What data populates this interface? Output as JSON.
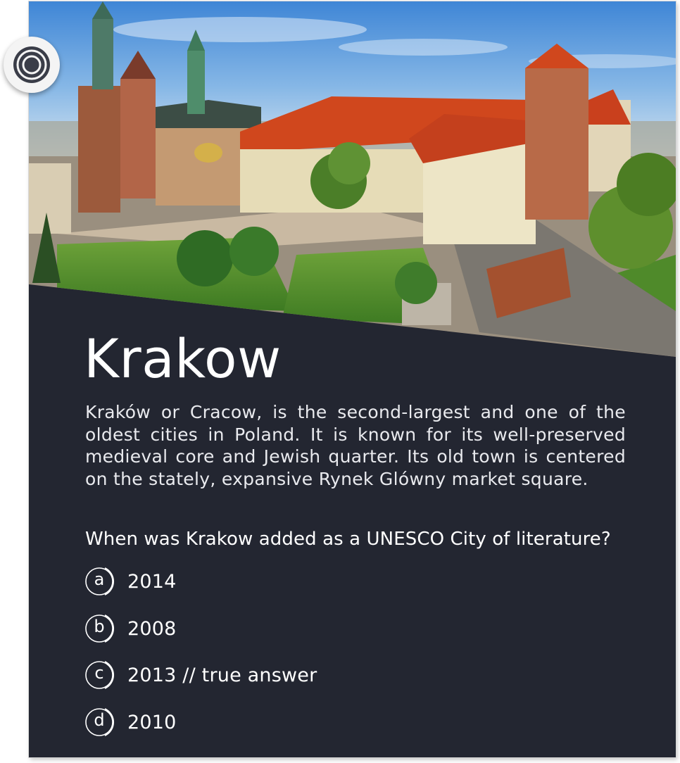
{
  "city": {
    "title": "Krakow",
    "description": "Kraków or Cracow, is the second-largest and one of the oldest cities in Poland. It is known for its well-preserved medieval core and Jewish quarter. Its old town is centered on the stately, expansive Rynek Glówny market square."
  },
  "question": "When was Krakow added as a UNESCO City of literature?",
  "answers": [
    {
      "letter": "a",
      "label": "2014"
    },
    {
      "letter": "b",
      "label": "2008"
    },
    {
      "letter": "c",
      "label": "2013 // true answer"
    },
    {
      "letter": "d",
      "label": "2010"
    }
  ],
  "colors": {
    "card_background": "#232631",
    "text": "#ffffff",
    "badge": "#f4f4f4",
    "badge_ring": "#3a3d48"
  },
  "icons": {
    "badge": "target-rings-icon",
    "hero": "wawel-castle-photo"
  }
}
